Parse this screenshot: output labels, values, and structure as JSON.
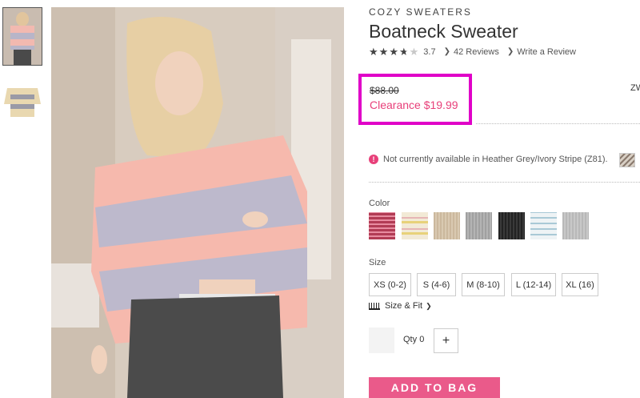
{
  "product": {
    "category": "COZY SWEATERS",
    "title": "Boatneck Sweater",
    "rating": 3.7,
    "rating_text": "3.7",
    "reviews_link": "42 Reviews",
    "write_review_link": "Write a Review"
  },
  "price": {
    "original": "$88.00",
    "clearance": "Clearance $19.99",
    "side_code": "ZW"
  },
  "availability": {
    "message": "Not currently available in Heather Grey/Ivory Stripe (Z81)."
  },
  "colors": {
    "label": "Color",
    "swatches": [
      {
        "name": "pink stripe",
        "color": "#c24a63"
      },
      {
        "name": "ivory yellow pattern",
        "color": "#eee0c4"
      },
      {
        "name": "oatmeal",
        "color": "#cbb89d"
      },
      {
        "name": "grey",
        "color": "#a8a8a8"
      },
      {
        "name": "black",
        "color": "#2b2b2b"
      },
      {
        "name": "light blue pattern",
        "color": "#dde8ec"
      },
      {
        "name": "heather grey",
        "color": "#bcbcbc"
      }
    ]
  },
  "sizes": {
    "label": "Size",
    "options": [
      "XS (0-2)",
      "S (4-6)",
      "M (8-10)",
      "L (12-14)",
      "XL (16)"
    ],
    "size_fit": "Size & Fit"
  },
  "quantity": {
    "label": "Qty",
    "value": "0",
    "plus": "+"
  },
  "cta": {
    "add_to_bag": "ADD TO BAG"
  },
  "colors_accent": {
    "highlight_box": "#e000c8",
    "sale_pink": "#e8407a",
    "button_pink": "#ea5a8a"
  }
}
